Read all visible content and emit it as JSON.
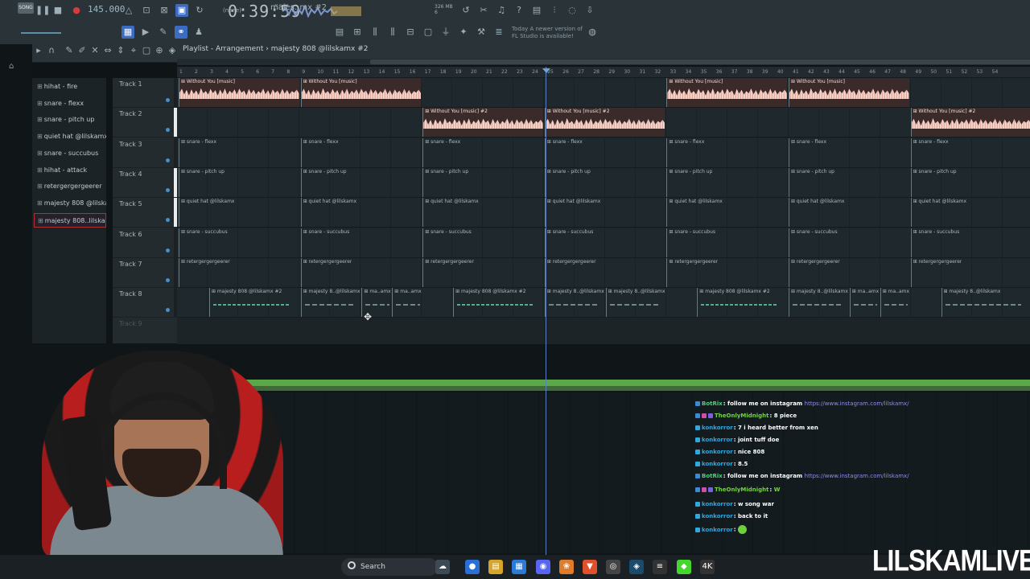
{
  "toolbar": {
    "song_label": "SONG",
    "bpm": "145.000",
    "time": "0:39:59",
    "time_unit": "M:S:CS",
    "cpu_mem": "326 MB",
    "cpu_val": "6",
    "line_label": "(none)",
    "pattern_name": "majes..mx #2",
    "new_version_line1": "Today  A newer version of",
    "new_version_line2": "FL Studio is available!",
    "icons": [
      "pause-icon",
      "stop-icon",
      "record-icon",
      "metronome-icon",
      "wait-icon",
      "countdown-icon",
      "loop-record-icon",
      "step-edit-icon"
    ]
  },
  "playlist": {
    "title_prefix": "Playlist - Arrangement",
    "title_sep": "›",
    "title_pattern": "majesty 808 @lilskamx #2",
    "ruler": [
      "1",
      "2",
      "3",
      "4",
      "5",
      "6",
      "7",
      "8",
      "9",
      "10",
      "11",
      "12",
      "13",
      "14",
      "15",
      "16",
      "17",
      "18",
      "19",
      "20",
      "21",
      "22",
      "23",
      "24",
      "25",
      "26",
      "27",
      "28",
      "29",
      "30",
      "31",
      "32",
      "33",
      "34",
      "35",
      "36",
      "37",
      "38",
      "39",
      "40",
      "41",
      "42",
      "43",
      "44",
      "45",
      "46",
      "47",
      "48",
      "49",
      "50",
      "51",
      "52",
      "53",
      "54"
    ]
  },
  "picker": {
    "items": [
      {
        "label": "hihat - fire",
        "selected": false
      },
      {
        "label": "snare - flexx",
        "selected": false
      },
      {
        "label": "snare - pitch up",
        "selected": false
      },
      {
        "label": "quiet hat @lilskamx",
        "selected": false
      },
      {
        "label": "snare - succubus",
        "selected": false
      },
      {
        "label": "hihat - attack",
        "selected": false
      },
      {
        "label": "retergergergeerer",
        "selected": false
      },
      {
        "label": "majesty 808 @lilskamx",
        "selected": false
      },
      {
        "label": "majesty 808..lilskamx #2",
        "selected": true
      }
    ]
  },
  "tracks": [
    {
      "name": "Track 1",
      "lit": false,
      "clips": [
        {
          "label": "Without You [music]",
          "kind": "audio",
          "start": 0,
          "len": 4
        },
        {
          "label": "Without You [music]",
          "kind": "audio",
          "start": 4,
          "len": 4
        },
        {
          "label": "Without You [music]",
          "kind": "audio",
          "start": 16,
          "len": 4
        },
        {
          "label": "Without You [music]",
          "kind": "audio",
          "start": 20,
          "len": 4
        }
      ]
    },
    {
      "name": "Track 2",
      "lit": true,
      "clips": [
        {
          "label": "Without You [music] #2",
          "kind": "audio",
          "start": 8,
          "len": 4
        },
        {
          "label": "Without You [music] #2",
          "kind": "audio",
          "start": 12,
          "len": 4
        },
        {
          "label": "Without You [music] #2",
          "kind": "audio",
          "start": 24,
          "len": 4
        }
      ]
    },
    {
      "name": "Track 3",
      "lit": false,
      "clips": [
        {
          "label": "snare - flexx",
          "kind": "pat",
          "start": 0,
          "len": 4
        },
        {
          "label": "snare - flexx",
          "kind": "pat",
          "start": 4,
          "len": 4
        },
        {
          "label": "snare - flexx",
          "kind": "pat",
          "start": 8,
          "len": 4
        },
        {
          "label": "snare - flexx",
          "kind": "pat",
          "start": 12,
          "len": 4
        },
        {
          "label": "snare - flexx",
          "kind": "pat",
          "start": 16,
          "len": 4
        },
        {
          "label": "snare - flexx",
          "kind": "pat",
          "start": 20,
          "len": 4
        },
        {
          "label": "snare - flexx",
          "kind": "pat",
          "start": 24,
          "len": 4
        }
      ]
    },
    {
      "name": "Track 4",
      "lit": true,
      "clips": [
        {
          "label": "snare - pitch up",
          "kind": "pat",
          "start": 0,
          "len": 4
        },
        {
          "label": "snare - pitch up",
          "kind": "pat",
          "start": 4,
          "len": 4
        },
        {
          "label": "snare - pitch up",
          "kind": "pat",
          "start": 8,
          "len": 4
        },
        {
          "label": "snare - pitch up",
          "kind": "pat",
          "start": 12,
          "len": 4
        },
        {
          "label": "snare - pitch up",
          "kind": "pat",
          "start": 16,
          "len": 4
        },
        {
          "label": "snare - pitch up",
          "kind": "pat",
          "start": 20,
          "len": 4
        },
        {
          "label": "snare - pitch up",
          "kind": "pat",
          "start": 24,
          "len": 4
        }
      ]
    },
    {
      "name": "Track 5",
      "lit": true,
      "clips": [
        {
          "label": "quiet hat @lilskamx",
          "kind": "pat",
          "start": 0,
          "len": 4
        },
        {
          "label": "quiet hat @lilskamx",
          "kind": "pat",
          "start": 4,
          "len": 4
        },
        {
          "label": "quiet hat @lilskamx",
          "kind": "pat",
          "start": 8,
          "len": 4
        },
        {
          "label": "quiet hat @lilskamx",
          "kind": "pat",
          "start": 12,
          "len": 4
        },
        {
          "label": "quiet hat @lilskamx",
          "kind": "pat",
          "start": 16,
          "len": 4
        },
        {
          "label": "quiet hat @lilskamx",
          "kind": "pat",
          "start": 20,
          "len": 4
        },
        {
          "label": "quiet hat @lilskamx",
          "kind": "pat",
          "start": 24,
          "len": 4
        }
      ]
    },
    {
      "name": "Track 6",
      "lit": false,
      "clips": [
        {
          "label": "snare - succubus",
          "kind": "pat",
          "start": 0,
          "len": 4
        },
        {
          "label": "snare - succubus",
          "kind": "pat",
          "start": 4,
          "len": 4
        },
        {
          "label": "snare - succubus",
          "kind": "pat",
          "start": 8,
          "len": 4
        },
        {
          "label": "snare - succubus",
          "kind": "pat",
          "start": 12,
          "len": 4
        },
        {
          "label": "snare - succubus",
          "kind": "pat",
          "start": 16,
          "len": 4
        },
        {
          "label": "snare - succubus",
          "kind": "pat",
          "start": 20,
          "len": 4
        },
        {
          "label": "snare - succubus",
          "kind": "pat",
          "start": 24,
          "len": 4
        }
      ]
    },
    {
      "name": "Track 7",
      "lit": false,
      "clips": [
        {
          "label": "retergergergeerer",
          "kind": "pat",
          "start": 0,
          "len": 4
        },
        {
          "label": "retergergergeerer",
          "kind": "pat",
          "start": 4,
          "len": 4
        },
        {
          "label": "retergergergeerer",
          "kind": "pat",
          "start": 8,
          "len": 4
        },
        {
          "label": "retergergergeerer",
          "kind": "pat",
          "start": 12,
          "len": 4
        },
        {
          "label": "retergergergeerer",
          "kind": "pat",
          "start": 16,
          "len": 4
        },
        {
          "label": "retergergergeerer",
          "kind": "pat",
          "start": 20,
          "len": 4
        },
        {
          "label": "retergergergeerer",
          "kind": "pat",
          "start": 24,
          "len": 4
        }
      ]
    },
    {
      "name": "Track 8",
      "lit": false,
      "clips": [
        {
          "label": "majesty 808 @lilskamx #2",
          "kind": "808g",
          "start": 1,
          "len": 3
        },
        {
          "label": "majesty 8..@lilskamx",
          "kind": "808",
          "start": 4,
          "len": 2
        },
        {
          "label": "ma..amx",
          "kind": "808",
          "start": 6,
          "len": 1
        },
        {
          "label": "ma..amx",
          "kind": "808",
          "start": 7,
          "len": 1
        },
        {
          "label": "majesty 808 @lilskamx #2",
          "kind": "808g",
          "start": 9,
          "len": 3
        },
        {
          "label": "majesty 8..@lilskamx",
          "kind": "808",
          "start": 12,
          "len": 2
        },
        {
          "label": "majesty 8..@lilskamx",
          "kind": "808",
          "start": 14,
          "len": 2
        },
        {
          "label": "majesty 808 @lilskamx #2",
          "kind": "808g",
          "start": 17,
          "len": 3
        },
        {
          "label": "majesty 8..@lilskamx",
          "kind": "808",
          "start": 20,
          "len": 2
        },
        {
          "label": "ma..amx",
          "kind": "808",
          "start": 22,
          "len": 1
        },
        {
          "label": "ma..amx",
          "kind": "808",
          "start": 23,
          "len": 1
        },
        {
          "label": "majesty 8..@lilskamx",
          "kind": "808",
          "start": 25,
          "len": 3
        }
      ]
    }
  ],
  "track9_label": "Track 9",
  "chat": [
    {
      "user": "BotRix",
      "color": "#4fd17a",
      "badges": [
        "#3a8ad6"
      ],
      "text": ": follow me on instagram ",
      "link": "https://www.instagram.com/lilskamx/"
    },
    {
      "user": "TheOnlyMidnight",
      "color": "#74d13f",
      "badges": [
        "#3a8ad6",
        "#d04fa8",
        "#7b5fe0"
      ],
      "text": ": 8 piece",
      "link": ""
    },
    {
      "user": "konkorror",
      "color": "#2fa8e0",
      "badges": [
        "#2fa8e0"
      ],
      "text": ": 7 i heard better from xen",
      "link": ""
    },
    {
      "user": "konkorror",
      "color": "#2fa8e0",
      "badges": [
        "#2fa8e0"
      ],
      "text": ": joint tuff doe",
      "link": ""
    },
    {
      "user": "konkorror",
      "color": "#2fa8e0",
      "badges": [
        "#2fa8e0"
      ],
      "text": ": nice 808",
      "link": ""
    },
    {
      "user": "konkorror",
      "color": "#2fa8e0",
      "badges": [
        "#2fa8e0"
      ],
      "text": ": 8.5",
      "link": ""
    },
    {
      "user": "BotRix",
      "color": "#4fd17a",
      "badges": [
        "#3a8ad6"
      ],
      "text": ": follow me on instagram ",
      "link": "https://www.instagram.com/lilskamx/"
    },
    {
      "user": "TheOnlyMidnight",
      "color": "#74d13f",
      "badges": [
        "#3a8ad6",
        "#d04fa8",
        "#7b5fe0"
      ],
      "text": ": ",
      "link": "",
      "emote": "W"
    },
    {
      "user": "konkorror",
      "color": "#2fa8e0",
      "badges": [
        "#2fa8e0"
      ],
      "text": ": w song war",
      "link": ""
    },
    {
      "user": "konkorror",
      "color": "#2fa8e0",
      "badges": [
        "#2fa8e0"
      ],
      "text": ": back to it",
      "link": ""
    },
    {
      "user": "konkorror",
      "color": "#2fa8e0",
      "badges": [
        "#2fa8e0"
      ],
      "text": ": ",
      "link": "",
      "emote": "green-face"
    }
  ],
  "taskbar": {
    "search_label": "Search",
    "apps": [
      {
        "name": "widgets-icon",
        "glyph": "☁",
        "color": "#3b4a55"
      },
      {
        "name": "chrome-icon",
        "glyph": "●",
        "color": "#2a6fd6"
      },
      {
        "name": "files-icon",
        "glyph": "▤",
        "color": "#d6a42a"
      },
      {
        "name": "store-icon",
        "glyph": "▦",
        "color": "#2a7ad6"
      },
      {
        "name": "discord-icon",
        "glyph": "◉",
        "color": "#5865f2"
      },
      {
        "name": "fl-studio-icon",
        "glyph": "❀",
        "color": "#e07b2a"
      },
      {
        "name": "brave-icon",
        "glyph": "▼",
        "color": "#e0502a"
      },
      {
        "name": "obs-icon",
        "glyph": "◎",
        "color": "#444"
      },
      {
        "name": "steam-icon",
        "glyph": "◈",
        "color": "#1b4a6b"
      },
      {
        "name": "ableton-icon",
        "glyph": "≡",
        "color": "#333"
      },
      {
        "name": "razer-icon",
        "glyph": "◆",
        "color": "#44d62c"
      },
      {
        "name": "4k-icon",
        "glyph": "4K",
        "color": "#333"
      }
    ]
  },
  "brand": "LILSKAMLIVE"
}
